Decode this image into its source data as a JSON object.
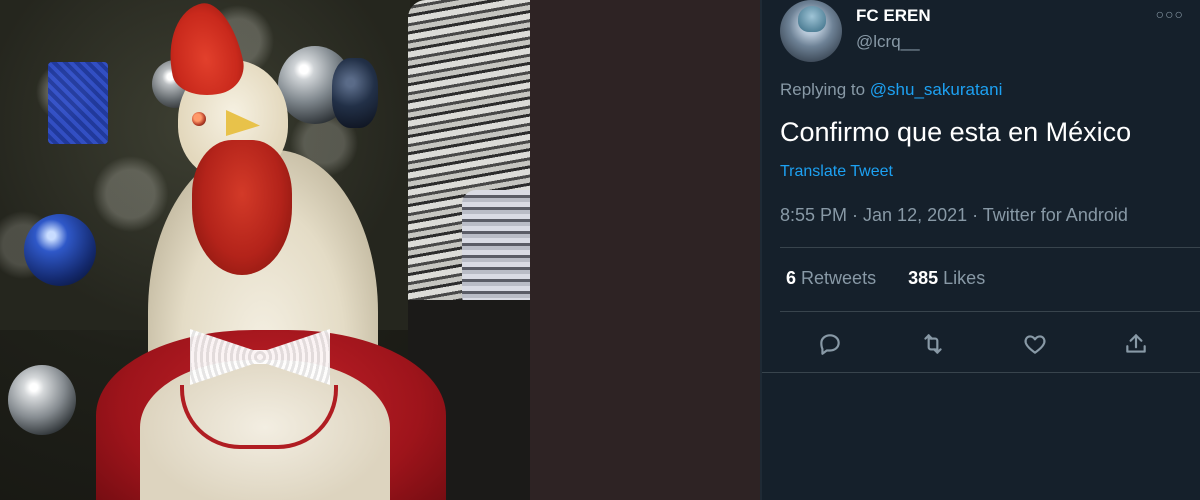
{
  "tweet": {
    "display_name": "FC EREN",
    "handle": "@lcrq__",
    "more_icon": "more-horizontal-icon",
    "replying_prefix": "Replying to",
    "replying_to": "@shu_sakuratani",
    "text": "Confirmo que esta en México",
    "translate_label": "Translate Tweet",
    "timestamp": "8:55 PM · Jan 12, 2021 · Twitter for Android",
    "retweets_count": "6",
    "retweets_label": "Retweets",
    "likes_count": "385",
    "likes_label": "Likes",
    "actions": [
      "reply-icon",
      "retweet-icon",
      "like-icon",
      "share-icon"
    ]
  },
  "colors": {
    "tweet_background": "#15202b",
    "accent": "#1da1f2",
    "muted_text": "#8899a6",
    "divider": "#38444d"
  }
}
